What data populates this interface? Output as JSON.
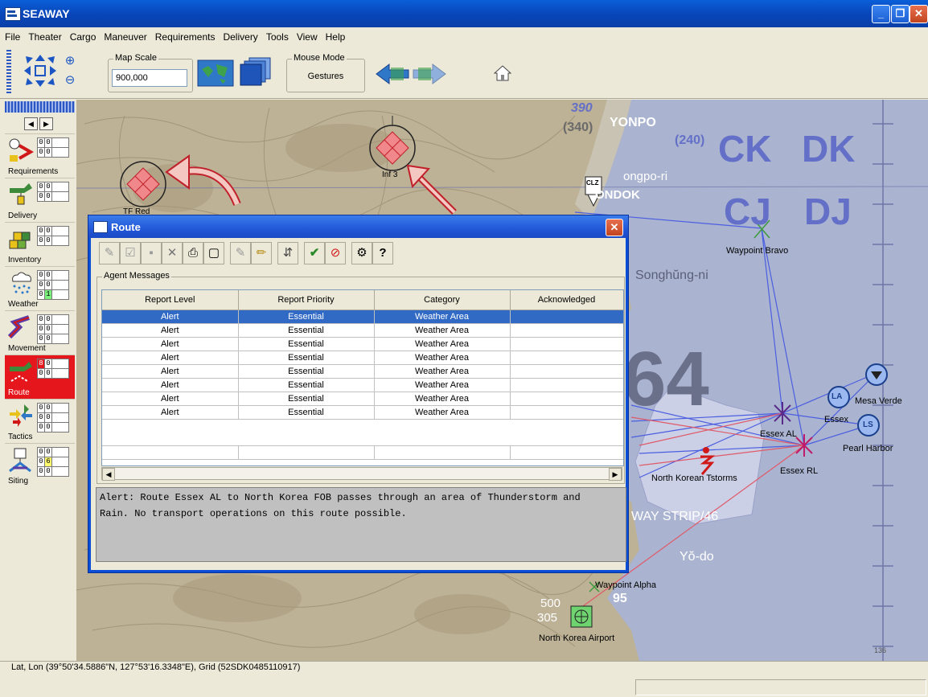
{
  "app": {
    "title": "SEAWAY"
  },
  "menu": [
    "File",
    "Theater",
    "Cargo",
    "Maneuver",
    "Requirements",
    "Delivery",
    "Tools",
    "View",
    "Help"
  ],
  "toolbar": {
    "map_scale_label": "Map Scale",
    "map_scale_value": "900,000",
    "mouse_mode_label": "Mouse Mode",
    "mouse_mode_value": "Gestures"
  },
  "palette": {
    "items": [
      {
        "label": "Requirements",
        "counts": [
          "0",
          "0",
          "0",
          "0"
        ]
      },
      {
        "label": "Delivery",
        "counts": [
          "0",
          "0",
          "0",
          "0"
        ]
      },
      {
        "label": "Inventory",
        "counts": [
          "0",
          "0",
          "0",
          "0"
        ]
      },
      {
        "label": "Weather",
        "counts": [
          "0",
          "0",
          "0",
          "0",
          "0",
          "1"
        ]
      },
      {
        "label": "Movement",
        "counts": [
          "0",
          "0",
          "0",
          "0",
          "0",
          "0"
        ]
      },
      {
        "label": "Route",
        "counts": [
          "8",
          "0",
          "0",
          "0"
        ]
      },
      {
        "label": "Tactics",
        "counts": [
          "0",
          "0",
          "0",
          "0",
          "0",
          "0"
        ]
      },
      {
        "label": "Siting",
        "counts": [
          "0",
          "0",
          "0",
          "6",
          "0",
          "0"
        ]
      }
    ]
  },
  "map": {
    "grid_labels": [
      "CK",
      "DK",
      "CJ",
      "DJ"
    ],
    "big_number": "64",
    "labels": {
      "waypoint_bravo": "Waypoint Bravo",
      "songhung": "Songhŭng-ni",
      "essex_al": "Essex AL",
      "essex_rl": "Essex RL",
      "essex": "Essex",
      "mesa_verde": "Mesa Verde",
      "pearl_harbor": "Pearl Harbor",
      "tstorms": "North Korean Tstorms",
      "airport": "North Korea Airport",
      "waypoint_alpha": "Waypoint Alpha",
      "strip": "WAY STRIP/46",
      "yodo": "Yŏ-do",
      "ondok": "ONDOK",
      "yonpo": "YONPO",
      "ongpo": "ongpo-ri",
      "clz": "CLZ",
      "inf3": "Inf 3",
      "tfred": "TF Red",
      "la": "LA",
      "ls": "LS",
      "h240": "(240)",
      "h340": "(340)",
      "h390": "390",
      "h500": "500",
      "h305": "305",
      "h95": "95",
      "h136": "136"
    }
  },
  "dialog": {
    "title": "Route",
    "group_label": "Agent Messages",
    "columns": [
      "Report Level",
      "Report Priority",
      "Category",
      "Acknowledged"
    ],
    "rows": [
      [
        "Alert",
        "Essential",
        "Weather Area",
        ""
      ],
      [
        "Alert",
        "Essential",
        "Weather Area",
        ""
      ],
      [
        "Alert",
        "Essential",
        "Weather Area",
        ""
      ],
      [
        "Alert",
        "Essential",
        "Weather Area",
        ""
      ],
      [
        "Alert",
        "Essential",
        "Weather Area",
        ""
      ],
      [
        "Alert",
        "Essential",
        "Weather Area",
        ""
      ],
      [
        "Alert",
        "Essential",
        "Weather Area",
        ""
      ],
      [
        "Alert",
        "Essential",
        "Weather Area",
        ""
      ]
    ],
    "message": "Alert: Route Essex AL to North Korea FOB passes through an area of Thunderstorm and\nRain. No transport operations on this route possible."
  },
  "status": {
    "coords": "Lat, Lon (39°50'34.5886\"N, 127°53'16.3348\"E), Grid (52SDK0485110917)"
  },
  "colors": {
    "accent": "#0a4ed6",
    "route_active": "#e5161c",
    "selection": "#316ac5",
    "map_sea": "#aab4d0",
    "map_land": "#c4b79b"
  }
}
